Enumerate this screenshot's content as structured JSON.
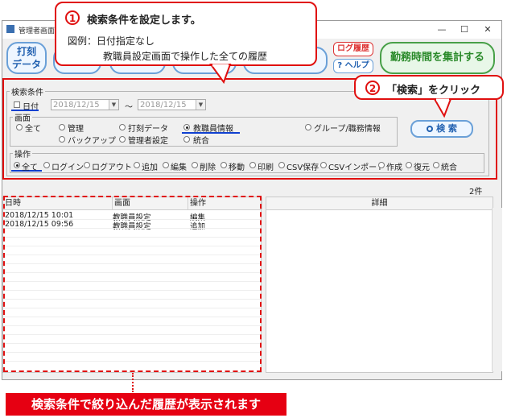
{
  "window": {
    "title": "管理者画面",
    "controls": {
      "min": "—",
      "max": "☐",
      "close": "✕"
    }
  },
  "toolbar": {
    "punch_label_line1": "打刻",
    "punch_label_line2": "データ",
    "log_label": "ログ履歴",
    "help_label": "? ヘルプ",
    "summary_label": "勤務時間を集計する"
  },
  "search": {
    "group_label": "検索条件",
    "date_checkbox_label": "日付",
    "date_from": "2018/12/15",
    "date_to": "2018/12/15",
    "tilde": "～",
    "screen_group_label": "画面",
    "screen_options": [
      "全て",
      "管理",
      "打刻データ",
      "教職員情報",
      "グループ/職務情報",
      "バックアップ",
      "管理者設定",
      "統合"
    ],
    "screen_selected": "教職員情報",
    "op_group_label": "操作",
    "op_options": [
      "全て",
      "ログイン",
      "ログアウト",
      "追加",
      "編集",
      "削除",
      "移動",
      "印刷",
      "CSV保存",
      "CSVインポート",
      "作成",
      "復元",
      "統合"
    ],
    "op_selected": "全て",
    "search_button_label": "検 索"
  },
  "result_count": "2件",
  "table": {
    "columns": [
      "日時",
      "画面",
      "操作"
    ],
    "rows": [
      {
        "datetime": "2018/12/15 10:01",
        "screen": "教職員設定",
        "op": "編集"
      },
      {
        "datetime": "2018/12/15 09:56",
        "screen": "教職員設定",
        "op": "追加"
      }
    ]
  },
  "detail": {
    "header": "詳細"
  },
  "annotations": {
    "callout1_number": "1",
    "callout1_title": "検索条件を設定します。",
    "callout1_line1": "図例：日付指定なし",
    "callout1_line2": "教職員設定画面で操作した全ての履歴",
    "callout2_number": "2",
    "callout2_text": "「検索」をクリック",
    "banner_text": "検索条件で絞り込んだ履歴が表示されます"
  },
  "colors": {
    "accent_red": "#e01010",
    "select_underline": "#1040d0",
    "summary_green": "#2a8a2a"
  }
}
